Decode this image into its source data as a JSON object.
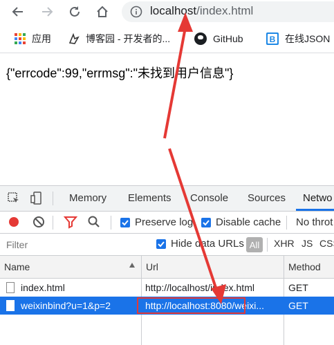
{
  "browser": {
    "url_host": "localhost",
    "url_path": "/index.html"
  },
  "bookmarks": [
    {
      "label": "应用",
      "icon": "apps-grid-icon"
    },
    {
      "label": "博客园 - 开发者的...",
      "icon": "cnblogs-icon"
    },
    {
      "label": "GitHub",
      "icon": "github-icon"
    },
    {
      "label": "在线JSON",
      "icon": "bejson-icon"
    }
  ],
  "page": {
    "response_text": "{\"errcode\":99,\"errmsg\":\"未找到用户信息\"}"
  },
  "devtools": {
    "tabs": [
      "Memory",
      "Elements",
      "Console",
      "Sources",
      "Netwo"
    ],
    "active_tab": "Netwo",
    "toolbar": {
      "preserve_log": {
        "label": "Preserve log",
        "checked": true
      },
      "disable_cache": {
        "label": "Disable cache",
        "checked": true
      },
      "throttle": "No throt"
    },
    "filter": {
      "placeholder": "Filter",
      "hide_data_urls": {
        "label": "Hide data URLs",
        "checked": true
      },
      "types": [
        "All",
        "XHR",
        "JS",
        "CSS"
      ]
    },
    "table": {
      "columns": [
        "Name",
        "Url",
        "Method"
      ],
      "rows": [
        {
          "name": "index.html",
          "url": "http://localhost/index.html",
          "method": "GET",
          "selected": false
        },
        {
          "name": "weixinbind?u=1&p=2",
          "url": "http://localhost:8080/weixi...",
          "method": "GET",
          "selected": true
        }
      ]
    }
  },
  "colors": {
    "accent": "#1a73e8",
    "annotation": "#e53935",
    "record": "#e53935"
  }
}
